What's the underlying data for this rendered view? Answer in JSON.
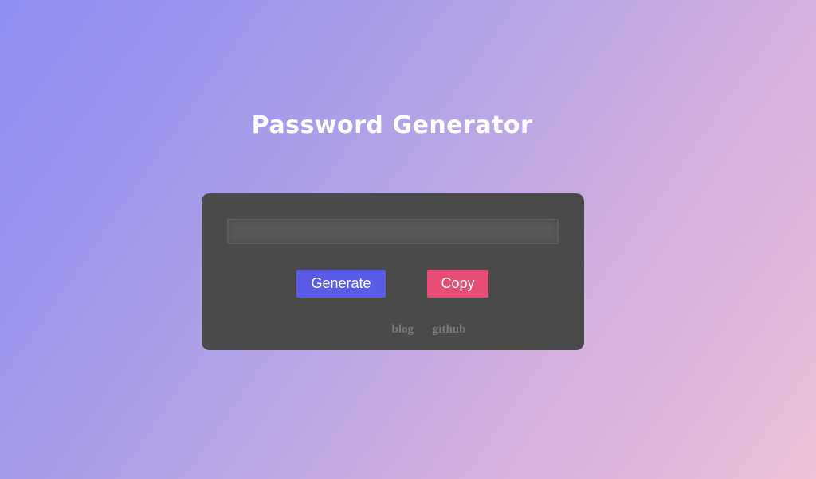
{
  "page": {
    "title": "Password Generator"
  },
  "generator": {
    "password_value": "",
    "generate_label": "Generate",
    "copy_label": "Copy"
  },
  "footer_links": {
    "blog": "blog",
    "github": "github"
  },
  "colors": {
    "card_background": "#4a4a4a",
    "generate_button": "#5a5ce8",
    "copy_button": "#e84d75",
    "link_text": "#7a7a7a",
    "title_text": "#ffffff"
  }
}
